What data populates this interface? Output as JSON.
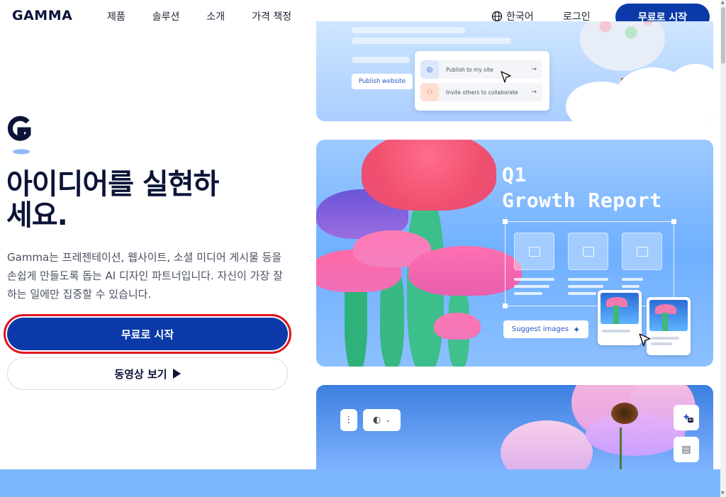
{
  "header": {
    "logo": "GAMMA",
    "nav": [
      "제품",
      "솔루션",
      "소개",
      "가격 책정"
    ],
    "language": "한국어",
    "login": "로그인",
    "cta": "무료로 시작"
  },
  "hero": {
    "title_line1": "아이디어를 실현하",
    "title_line2": "세요.",
    "description": "Gamma는 프레젠테이션, 웹사이트, 소셜 미디어 게시물 등을 손쉽게 만들도록 돕는 AI 디자인 파트너입니다. 자신이 가장 잘하는 일에만 집중할 수 있습니다.",
    "primary_button": "무료로 시작",
    "secondary_button": "동영상 보기"
  },
  "card_publish": {
    "publish_button": "Publish website",
    "menu": [
      {
        "label": "Publish to my site",
        "icon": "globe-icon"
      },
      {
        "label": "Invite others to collaborate",
        "icon": "users-icon"
      }
    ]
  },
  "card_report": {
    "title_line1": "Q1",
    "title_line2": "Growth Report",
    "suggest_button": "Suggest images"
  },
  "card_flower": {
    "side_tool_ai_badge": "AI"
  },
  "colors": {
    "brand_blue": "#0b3aa8",
    "highlight_red": "#e0141c",
    "hero_text": "#0b1436"
  }
}
